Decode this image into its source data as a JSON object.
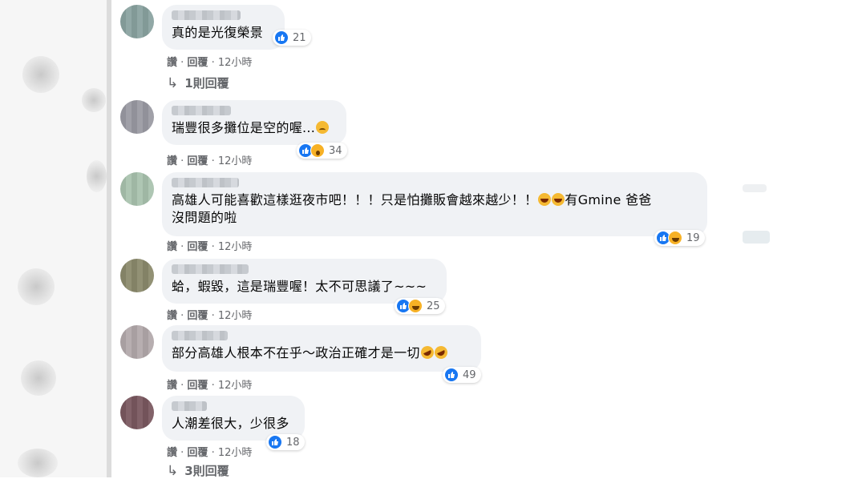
{
  "comments": [
    {
      "text": "真的是光復榮景",
      "emoji": "",
      "reactions": [
        "like"
      ],
      "count": "21",
      "actions": {
        "like": "讚",
        "reply": "回覆",
        "time": "12小時"
      },
      "replies": "1則回覆"
    },
    {
      "text": "瑞豐很多攤位是空的喔...",
      "emoji": "sad",
      "reactions": [
        "like",
        "wow"
      ],
      "count": "34",
      "actions": {
        "like": "讚",
        "reply": "回覆",
        "time": "12小時"
      }
    },
    {
      "text_line1": "高雄人可能喜歡這樣逛夜市吧！！！只是怕攤販會越來越少！！",
      "text_line1_suffix": "有Gmine 爸爸",
      "text_line2": "沒問題的啦",
      "reactions": [
        "like",
        "haha"
      ],
      "count": "19",
      "actions": {
        "like": "讚",
        "reply": "回覆",
        "time": "12小時"
      }
    },
    {
      "text": "蛤，蝦毀，這是瑞豐喔！太不可思議了~~~",
      "reactions": [
        "like",
        "haha"
      ],
      "count": "25",
      "actions": {
        "like": "讚",
        "reply": "回覆",
        "time": "12小時"
      }
    },
    {
      "text": "部分高雄人根本不在乎～政治正確才是一切",
      "reactions": [
        "like"
      ],
      "count": "49",
      "actions": {
        "like": "讚",
        "reply": "回覆",
        "time": "12小時"
      }
    },
    {
      "text": "人潮差很大，少很多",
      "reactions": [
        "like"
      ],
      "count": "18",
      "actions": {
        "like": "讚",
        "reply": "回覆",
        "time": "12小時"
      },
      "replies": "3則回覆"
    }
  ],
  "colors": {
    "like": "#1877f2",
    "emoji_yellow": "#f7b125",
    "bubble": "#f0f2f5",
    "meta_text": "#65676b"
  }
}
